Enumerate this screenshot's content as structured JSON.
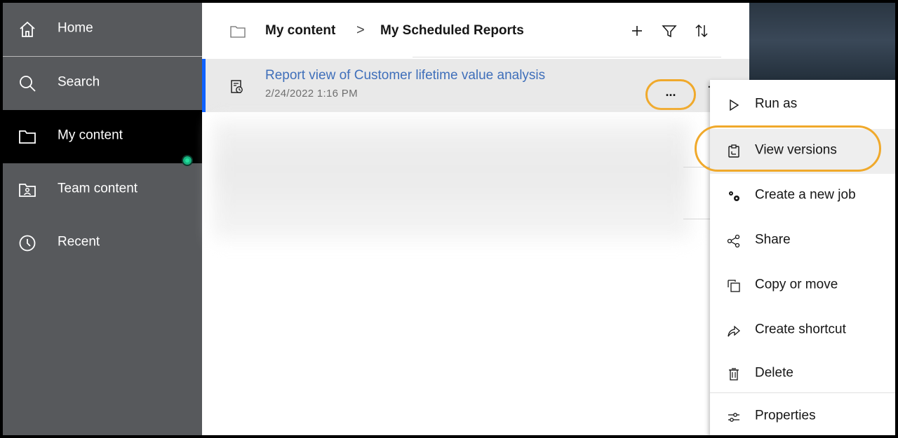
{
  "sidebar": {
    "items": [
      {
        "label": "Home",
        "icon": "home-icon"
      },
      {
        "label": "Search",
        "icon": "search-icon"
      },
      {
        "label": "My content",
        "icon": "folder-icon",
        "active": true
      },
      {
        "label": "Team content",
        "icon": "team-folder-icon"
      },
      {
        "label": "Recent",
        "icon": "clock-icon"
      }
    ]
  },
  "breadcrumb": {
    "root": "My content",
    "separator": ">",
    "current": "My Scheduled Reports"
  },
  "toolbar": {
    "add": "+",
    "filter": "filter-icon",
    "sort": "sort-icon"
  },
  "list": {
    "rows": [
      {
        "title": "Report view of Customer lifetime value analysis",
        "date": "2/24/2022 1:16 PM",
        "more_label": "...",
        "more_tail": "."
      }
    ]
  },
  "menu": {
    "items": [
      {
        "label": "Run as",
        "icon": "play-icon"
      },
      {
        "label": "View versions",
        "icon": "versions-icon",
        "highlighted": true
      },
      {
        "label": "Create a new job",
        "icon": "gears-icon"
      },
      {
        "label": "Share",
        "icon": "share-icon"
      },
      {
        "label": "Copy or move",
        "icon": "copy-icon"
      },
      {
        "label": "Create shortcut",
        "icon": "shortcut-icon"
      },
      {
        "label": "Delete",
        "icon": "trash-icon"
      },
      {
        "label": "Properties",
        "icon": "sliders-icon"
      }
    ]
  },
  "colors": {
    "sidebar": "#57595c",
    "active": "#000000",
    "accent": "#0f62fe",
    "link": "#3f6fba",
    "highlight_ring": "#f0a92b",
    "notify": "#18b27f"
  }
}
